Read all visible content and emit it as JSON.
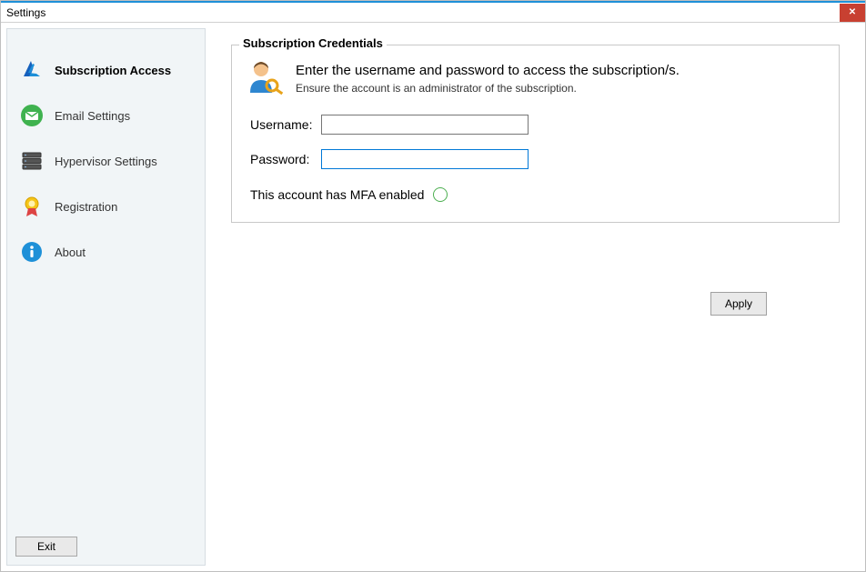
{
  "window": {
    "title": "Settings"
  },
  "sidebar": {
    "items": [
      {
        "label": "Subscription Access",
        "selected": true
      },
      {
        "label": "Email Settings",
        "selected": false
      },
      {
        "label": "Hypervisor Settings",
        "selected": false
      },
      {
        "label": "Registration",
        "selected": false
      },
      {
        "label": "About",
        "selected": false
      }
    ],
    "exit_label": "Exit"
  },
  "credentials": {
    "legend": "Subscription Credentials",
    "heading": "Enter the username and password to access the subscription/s.",
    "subheading": "Ensure the account is an administrator of the subscription.",
    "username_label": "Username:",
    "username_value": "",
    "password_label": "Password:",
    "password_value": "",
    "mfa_label": "This account has MFA enabled",
    "mfa_checked": false
  },
  "buttons": {
    "apply": "Apply"
  }
}
